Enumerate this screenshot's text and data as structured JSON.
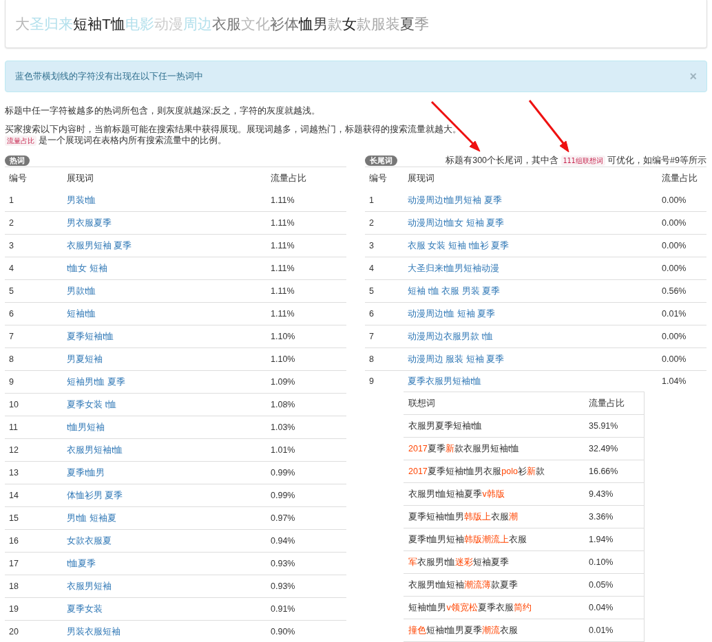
{
  "title_card": {
    "segments": [
      {
        "text": "大",
        "color": "#b8b8b8"
      },
      {
        "text": "圣归来",
        "color": "#b3e0ec"
      },
      {
        "text": "短袖T恤",
        "color": "#222222"
      },
      {
        "text": "电影",
        "color": "#b3e0ec"
      },
      {
        "text": "动漫",
        "color": "#cccccc"
      },
      {
        "text": "周边",
        "color": "#b3e0ec"
      },
      {
        "text": "衣服",
        "color": "#777777"
      },
      {
        "text": "文化",
        "color": "#b8b8b8"
      },
      {
        "text": "衫体",
        "color": "#777777"
      },
      {
        "text": "恤",
        "color": "#111111"
      },
      {
        "text": "男",
        "color": "#444444"
      },
      {
        "text": "款",
        "color": "#aaaaaa"
      },
      {
        "text": "女",
        "color": "#222222"
      },
      {
        "text": "款服装",
        "color": "#aaaaaa"
      },
      {
        "text": "夏",
        "color": "#555555"
      },
      {
        "text": "季",
        "color": "#999999"
      }
    ]
  },
  "alert": {
    "message": "蓝色带横划线的字符没有出现在以下任一热词中",
    "close": "×"
  },
  "notes": [
    "标题中任一字符被越多的热词所包含，则灰度就越深;反之，字符的灰度就越浅。",
    "买家搜索以下内容时，当前标题可能在搜索结果中获得展现。展现词越多，词越热门，标题获得的搜索流量就越大。"
  ],
  "legend": {
    "code": "流量占比",
    "text": "是一个展现词在表格内所有搜索流量中的比例。"
  },
  "hot_words": {
    "badge": "热词",
    "columns": [
      "编号",
      "展现词",
      "流量占比"
    ],
    "rows": [
      {
        "number": "1",
        "keyword": "男装t恤",
        "share": "1.11%"
      },
      {
        "number": "2",
        "keyword": "男衣服夏季",
        "share": "1.11%"
      },
      {
        "number": "3",
        "keyword": "衣服男短袖 夏季",
        "share": "1.11%"
      },
      {
        "number": "4",
        "keyword": "t恤女 短袖",
        "share": "1.11%"
      },
      {
        "number": "5",
        "keyword": "男款t恤",
        "share": "1.11%"
      },
      {
        "number": "6",
        "keyword": "短袖t恤",
        "share": "1.11%"
      },
      {
        "number": "7",
        "keyword": "夏季短袖t恤",
        "share": "1.10%"
      },
      {
        "number": "8",
        "keyword": "男夏短袖",
        "share": "1.10%"
      },
      {
        "number": "9",
        "keyword": "短袖男t恤 夏季",
        "share": "1.09%"
      },
      {
        "number": "10",
        "keyword": "夏季女装 t恤",
        "share": "1.08%"
      },
      {
        "number": "11",
        "keyword": "t恤男短袖",
        "share": "1.03%"
      },
      {
        "number": "12",
        "keyword": "衣服男短袖t恤",
        "share": "1.01%"
      },
      {
        "number": "13",
        "keyword": "夏季t恤男",
        "share": "0.99%"
      },
      {
        "number": "14",
        "keyword": "体恤衫男 夏季",
        "share": "0.99%"
      },
      {
        "number": "15",
        "keyword": "男t恤 短袖夏",
        "share": "0.97%"
      },
      {
        "number": "16",
        "keyword": "女款衣服夏",
        "share": "0.94%"
      },
      {
        "number": "17",
        "keyword": "t恤夏季",
        "share": "0.93%"
      },
      {
        "number": "18",
        "keyword": "衣服男短袖",
        "share": "0.93%"
      },
      {
        "number": "19",
        "keyword": "夏季女装",
        "share": "0.91%"
      },
      {
        "number": "20",
        "keyword": "男装衣服短袖",
        "share": "0.90%"
      }
    ]
  },
  "long_tail": {
    "badge": "长尾词",
    "summary": {
      "before": "标题有300个长尾词，其中含",
      "code": "111组联想词",
      "after": "可优化，如编号#9等所示"
    },
    "columns": [
      "编号",
      "展现词",
      "流量占比"
    ],
    "rows": [
      {
        "number": "1",
        "keyword": "动漫周边t恤男短袖 夏季",
        "share": "0.00%"
      },
      {
        "number": "2",
        "keyword": "动漫周边t恤女 短袖 夏季",
        "share": "0.00%"
      },
      {
        "number": "3",
        "keyword": "衣服 女装 短袖 t恤衫 夏季",
        "share": "0.00%"
      },
      {
        "number": "4",
        "keyword": "大圣归来t恤男短袖动漫",
        "share": "0.00%"
      },
      {
        "number": "5",
        "keyword": "短袖 t恤 衣服 男装 夏季",
        "share": "0.56%"
      },
      {
        "number": "6",
        "keyword": "动漫周边t恤 短袖 夏季",
        "share": "0.01%"
      },
      {
        "number": "7",
        "keyword": "动漫周边衣服男款 t恤",
        "share": "0.00%"
      },
      {
        "number": "8",
        "keyword": "动漫周边 服装 短袖 夏季",
        "share": "0.00%"
      },
      {
        "number": "9",
        "keyword": "夏季衣服男短袖t恤",
        "share": "1.04%",
        "suggestions": {
          "columns": [
            "联想词",
            "流量占比"
          ],
          "rows": [
            {
              "parts": [
                {
                  "text": "衣服男夏季短袖t恤",
                  "highlight": false
                }
              ],
              "share": "35.91%"
            },
            {
              "parts": [
                {
                  "text": "2017",
                  "highlight": true
                },
                {
                  "text": "夏季",
                  "highlight": false
                },
                {
                  "text": "新",
                  "highlight": true
                },
                {
                  "text": "款衣服男短袖t恤",
                  "highlight": false
                }
              ],
              "share": "32.49%"
            },
            {
              "parts": [
                {
                  "text": "2017",
                  "highlight": true
                },
                {
                  "text": "夏季短袖t恤男衣服",
                  "highlight": false
                },
                {
                  "text": "polo",
                  "highlight": true
                },
                {
                  "text": "衫",
                  "highlight": false
                },
                {
                  "text": "新",
                  "highlight": true
                },
                {
                  "text": "款",
                  "highlight": false
                }
              ],
              "share": "16.66%"
            },
            {
              "parts": [
                {
                  "text": "衣服男t恤短袖夏季",
                  "highlight": false
                },
                {
                  "text": "v韩版",
                  "highlight": true
                }
              ],
              "share": "9.43%"
            },
            {
              "parts": [
                {
                  "text": "夏季短袖t恤男",
                  "highlight": false
                },
                {
                  "text": "韩版上",
                  "highlight": true
                },
                {
                  "text": "衣服",
                  "highlight": false
                },
                {
                  "text": "潮",
                  "highlight": true
                }
              ],
              "share": "3.36%"
            },
            {
              "parts": [
                {
                  "text": "夏季t恤男短袖",
                  "highlight": false
                },
                {
                  "text": "韩版潮流上",
                  "highlight": true
                },
                {
                  "text": "衣服",
                  "highlight": false
                }
              ],
              "share": "1.94%"
            },
            {
              "parts": [
                {
                  "text": "军",
                  "highlight": true
                },
                {
                  "text": "衣服男t恤",
                  "highlight": false
                },
                {
                  "text": "迷彩",
                  "highlight": true
                },
                {
                  "text": "短袖夏季",
                  "highlight": false
                }
              ],
              "share": "0.10%"
            },
            {
              "parts": [
                {
                  "text": "衣服男t恤短袖",
                  "highlight": false
                },
                {
                  "text": "潮流薄",
                  "highlight": true
                },
                {
                  "text": "款夏季",
                  "highlight": false
                }
              ],
              "share": "0.05%"
            },
            {
              "parts": [
                {
                  "text": "短袖t恤男",
                  "highlight": false
                },
                {
                  "text": "v领宽松",
                  "highlight": true
                },
                {
                  "text": "夏季衣服",
                  "highlight": false
                },
                {
                  "text": "简约",
                  "highlight": true
                }
              ],
              "share": "0.04%"
            },
            {
              "parts": [
                {
                  "text": "撞色",
                  "highlight": true
                },
                {
                  "text": "短袖t恤男夏季",
                  "highlight": false
                },
                {
                  "text": "潮流",
                  "highlight": true
                },
                {
                  "text": "衣服",
                  "highlight": false
                }
              ],
              "share": "0.01%"
            }
          ]
        }
      }
    ]
  }
}
